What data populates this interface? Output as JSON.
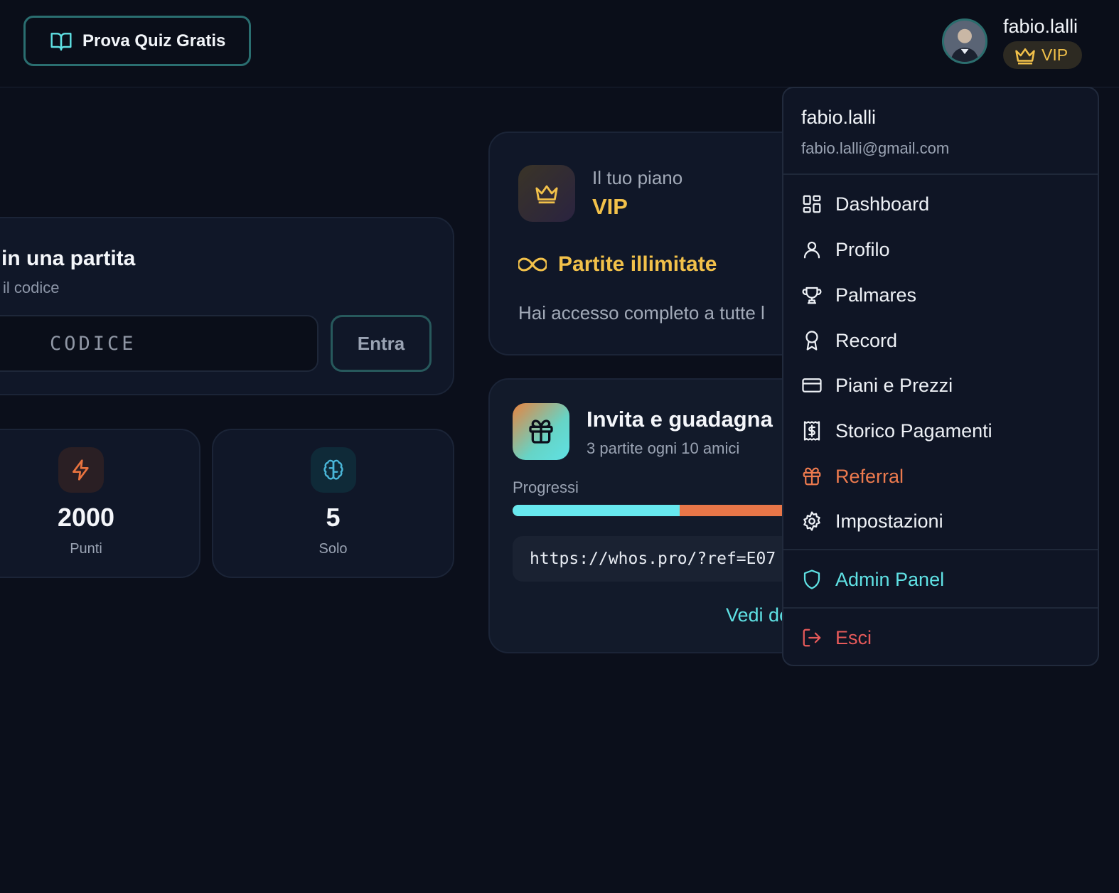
{
  "header": {
    "quiz_button": "Prova Quiz Gratis",
    "user_name": "fabio.lalli",
    "badge": "VIP"
  },
  "join": {
    "title": "in una partita",
    "subtitle": "il codice",
    "code_placeholder": "CODICE",
    "enter_label": "Entra"
  },
  "stats": [
    {
      "value": "2000",
      "label": "Punti",
      "icon": "lightning-icon",
      "color": "#e8733f"
    },
    {
      "value": "5",
      "label": "Solo",
      "icon": "brain-icon",
      "color": "#4ab7d9"
    }
  ],
  "plan": {
    "label": "Il tuo piano",
    "name": "VIP",
    "unlimited": "Partite illimitate",
    "description": "Hai accesso completo a tutte l"
  },
  "referral_card": {
    "title": "Invita e guadagna",
    "subtitle": "3 partite ogni 10 amici",
    "progress_label": "Progressi",
    "progress": 0.56,
    "link": "https://whos.pro/?ref=E07",
    "more": "Vedi de"
  },
  "dropdown": {
    "name": "fabio.lalli",
    "email": "fabio.lalli@gmail.com",
    "items": [
      {
        "label": "Dashboard",
        "icon": "dashboard-icon"
      },
      {
        "label": "Profilo",
        "icon": "user-icon"
      },
      {
        "label": "Palmares",
        "icon": "trophy-icon"
      },
      {
        "label": "Record",
        "icon": "award-icon"
      },
      {
        "label": "Piani e Prezzi",
        "icon": "credit-card-icon"
      },
      {
        "label": "Storico Pagamenti",
        "icon": "receipt-icon"
      },
      {
        "label": "Referral",
        "icon": "gift-icon"
      },
      {
        "label": "Impostazioni",
        "icon": "gear-icon"
      }
    ],
    "admin": "Admin Panel",
    "logout": "Esci"
  },
  "colors": {
    "accent_cyan": "#5fe1e4",
    "gold": "#f2c14a",
    "orange": "#ec7a4e",
    "danger": "#e75a5a",
    "background": "#0b0f1b"
  }
}
